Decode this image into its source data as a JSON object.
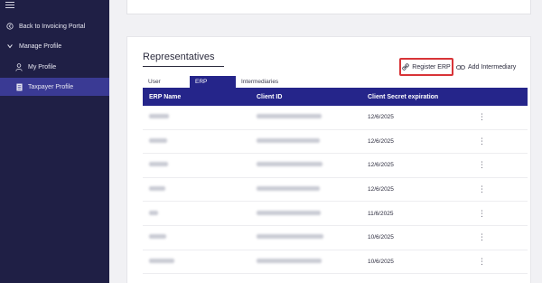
{
  "sidebar": {
    "items": [
      {
        "label": "Back to Invoicing Portal",
        "icon": "arrow-left-circle-icon"
      },
      {
        "label": "Manage Profile",
        "icon": "chevron-down-icon"
      },
      {
        "label": "My Profile",
        "icon": "person-icon"
      },
      {
        "label": "Taxpayer Profile",
        "icon": "document-icon"
      }
    ]
  },
  "representatives": {
    "title": "Representatives",
    "register_erp_label": "Register ERP",
    "add_intermediary_label": "Add Intermediary",
    "tabs": [
      {
        "label": "User"
      },
      {
        "label": "ERP",
        "active": true
      },
      {
        "label": "Intermediaries"
      }
    ],
    "columns": [
      "ERP Name",
      "Client ID",
      "Client Secret expiration"
    ],
    "rows": [
      {
        "expiration": "12/6/2025"
      },
      {
        "expiration": "12/6/2025"
      },
      {
        "expiration": "12/6/2025"
      },
      {
        "expiration": "12/6/2025"
      },
      {
        "expiration": "11/6/2025"
      },
      {
        "expiration": "10/6/2025"
      },
      {
        "expiration": "10/6/2025"
      }
    ]
  },
  "colors": {
    "sidebar_bg": "#1f1f45",
    "active_nav": "#3a3a94",
    "table_header": "#25258a",
    "highlight_border": "#d83438"
  }
}
